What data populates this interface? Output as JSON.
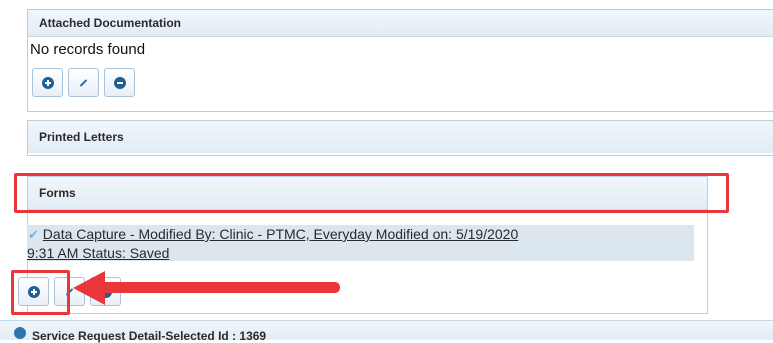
{
  "attached_documentation": {
    "title": "Attached Documentation",
    "empty_message": "No records found",
    "buttons": [
      {
        "icon": "add-icon",
        "label": "Add"
      },
      {
        "icon": "edit-icon",
        "label": "Edit"
      },
      {
        "icon": "remove-icon",
        "label": "Remove"
      }
    ]
  },
  "printed_letters": {
    "title": "Printed Letters"
  },
  "forms": {
    "title": "Forms",
    "items": [
      {
        "check_icon": "✔",
        "text_line1": "Data Capture - Modified By: Clinic - PTMC, Everyday Modified on: 5/19/2020",
        "text_line2": "9:31 AM Status: Saved"
      }
    ],
    "buttons": [
      {
        "icon": "add-icon",
        "label": "Add"
      },
      {
        "icon": "edit-icon",
        "label": "Edit"
      },
      {
        "icon": "remove-icon",
        "label": "Remove"
      }
    ]
  },
  "service_request": {
    "title": "Service Request Detail-Selected Id : 1369"
  },
  "annotation": {
    "color": "#e8363a"
  }
}
